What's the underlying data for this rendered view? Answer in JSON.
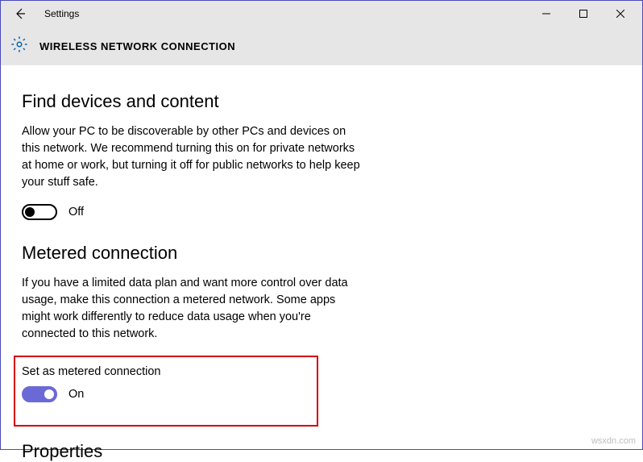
{
  "window": {
    "app_title": "Settings"
  },
  "header": {
    "page_title": "WIRELESS NETWORK CONNECTION"
  },
  "sections": {
    "find": {
      "heading": "Find devices and content",
      "description": "Allow your PC to be discoverable by other PCs and devices on this network. We recommend turning this on for private networks at home or work, but turning it off for public networks to help keep your stuff safe.",
      "toggle_state_label": "Off"
    },
    "metered": {
      "heading": "Metered connection",
      "description": "If you have a limited data plan and want more control over data usage, make this connection a metered network. Some apps might work differently to reduce data usage when you're connected to this network.",
      "set_label": "Set as metered connection",
      "toggle_state_label": "On"
    },
    "properties": {
      "heading": "Properties"
    }
  },
  "watermark": "wsxdn.com"
}
